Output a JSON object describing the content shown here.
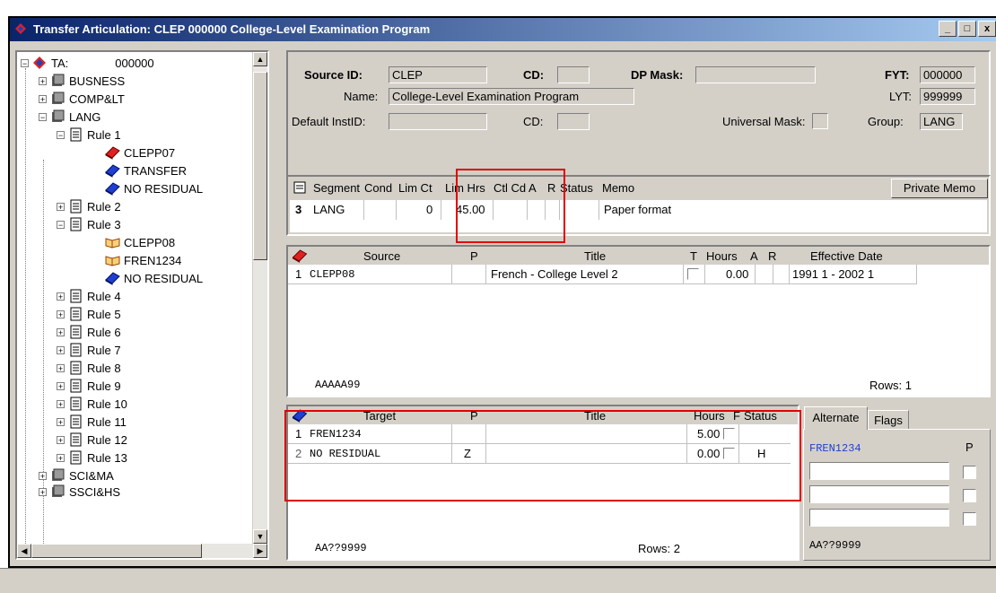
{
  "window": {
    "title": "Transfer Articulation: CLEP  000000 College-Level Examination Program",
    "buttons": [
      "_",
      "□",
      "x"
    ]
  },
  "tree": {
    "root": {
      "label": "TA:",
      "code": "000000"
    },
    "items": [
      {
        "label": "BUSNESS"
      },
      {
        "label": "COMP&LT"
      },
      {
        "label": "LANG"
      },
      {
        "label": "Rule 1"
      },
      {
        "label": "CLEPP07"
      },
      {
        "label": "TRANSFER"
      },
      {
        "label": "NO RESIDUAL"
      },
      {
        "label": "Rule 2"
      },
      {
        "label": "Rule 3"
      },
      {
        "label": "CLEPP08"
      },
      {
        "label": "FREN1234"
      },
      {
        "label": "NO RESIDUAL"
      },
      {
        "label": "Rule 4"
      },
      {
        "label": "Rule 5"
      },
      {
        "label": "Rule 6"
      },
      {
        "label": "Rule 7"
      },
      {
        "label": "Rule 8"
      },
      {
        "label": "Rule 9"
      },
      {
        "label": "Rule 10"
      },
      {
        "label": "Rule 11"
      },
      {
        "label": "Rule 12"
      },
      {
        "label": "Rule 13"
      },
      {
        "label": "SCI&MA"
      },
      {
        "label": "SSCI&HS"
      }
    ]
  },
  "header": {
    "source_id_label": "Source ID:",
    "source_id": "CLEP",
    "cd_label": "CD:",
    "cd": "",
    "dp_mask_label": "DP Mask:",
    "dp_mask": "",
    "fyt_label": "FYT:",
    "fyt": "000000",
    "name_label": "Name:",
    "name": "College-Level Examination Program",
    "lyt_label": "LYT:",
    "lyt": "999999",
    "default_inst_label": "Default InstID:",
    "default_inst": "",
    "cd2_label": "CD:",
    "cd2": "",
    "universal_mask_label": "Universal Mask:",
    "group_label": "Group:",
    "group": "LANG"
  },
  "segment": {
    "columns": [
      "Segment",
      "Cond",
      "Lim Ct",
      "Lim Hrs",
      "Ctl Cd",
      "A",
      "R",
      "Status",
      "Memo"
    ],
    "row": {
      "num": "3",
      "segment": "LANG",
      "lim_ct": "0",
      "lim_hrs": "45.00",
      "memo": "Paper format"
    },
    "private_memo": "Private Memo"
  },
  "source_grid": {
    "columns": [
      "Source",
      "P",
      "Title",
      "T",
      "Hours",
      "A",
      "R",
      "Effective Date"
    ],
    "rows": [
      {
        "num": "1",
        "source": "CLEPP08",
        "p": "",
        "title": "French - College Level 2",
        "hours": "0.00",
        "eff": "1991 1  - 2002 1"
      }
    ],
    "mask": "AAAAA99",
    "rows_label": "Rows: 1"
  },
  "target_grid": {
    "columns": [
      "Target",
      "P",
      "Title",
      "Hours",
      "F",
      "Status"
    ],
    "rows": [
      {
        "num": "1",
        "target": "FREN1234",
        "p": "",
        "title": "",
        "hours": "5.00",
        "status": ""
      },
      {
        "num": "2",
        "target": "NO RESIDUAL",
        "p": "Z",
        "title": "",
        "hours": "0.00",
        "status": "H"
      }
    ],
    "mask": "AA??9999",
    "rows_label": "Rows: 2"
  },
  "alternate": {
    "tabs": [
      "Alternate",
      "Flags"
    ],
    "value": "FREN1234",
    "p_label": "P",
    "mask": "AA??9999"
  }
}
